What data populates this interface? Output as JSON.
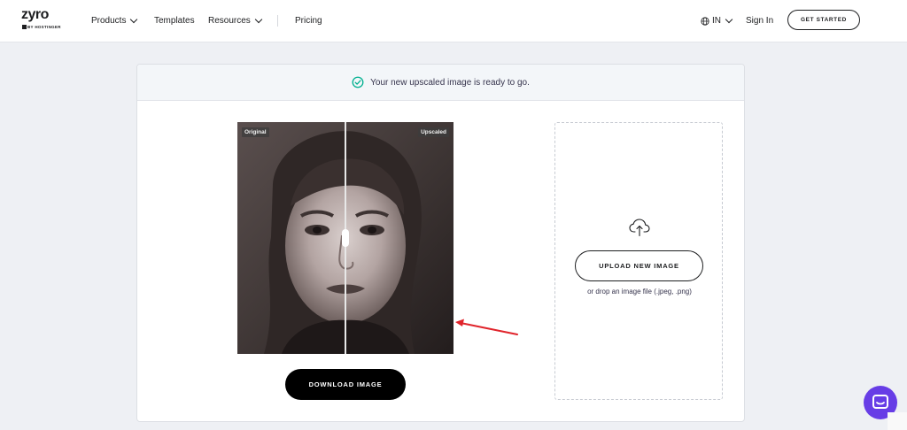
{
  "header": {
    "logo_text": "zyro",
    "logo_sub": "BY HOSTINGER",
    "nav": {
      "products": "Products",
      "templates": "Templates",
      "resources": "Resources",
      "pricing": "Pricing"
    },
    "language": "IN",
    "signin": "Sign In",
    "cta": "GET STARTED"
  },
  "banner": {
    "message": "Your new upscaled image is ready to go."
  },
  "compare": {
    "label_left": "Original",
    "label_right": "Upscaled",
    "download_label": "DOWNLOAD IMAGE"
  },
  "upload": {
    "button_label": "UPLOAD NEW IMAGE",
    "hint": "or drop an image file (.jpeg, .png)"
  },
  "colors": {
    "accent": "#673de6",
    "success": "#00b090",
    "annotation": "#e0242b"
  },
  "icons": [
    "check-circle-icon",
    "globe-icon",
    "chevron-down-icon",
    "cloud-upload-icon",
    "chat-icon"
  ]
}
